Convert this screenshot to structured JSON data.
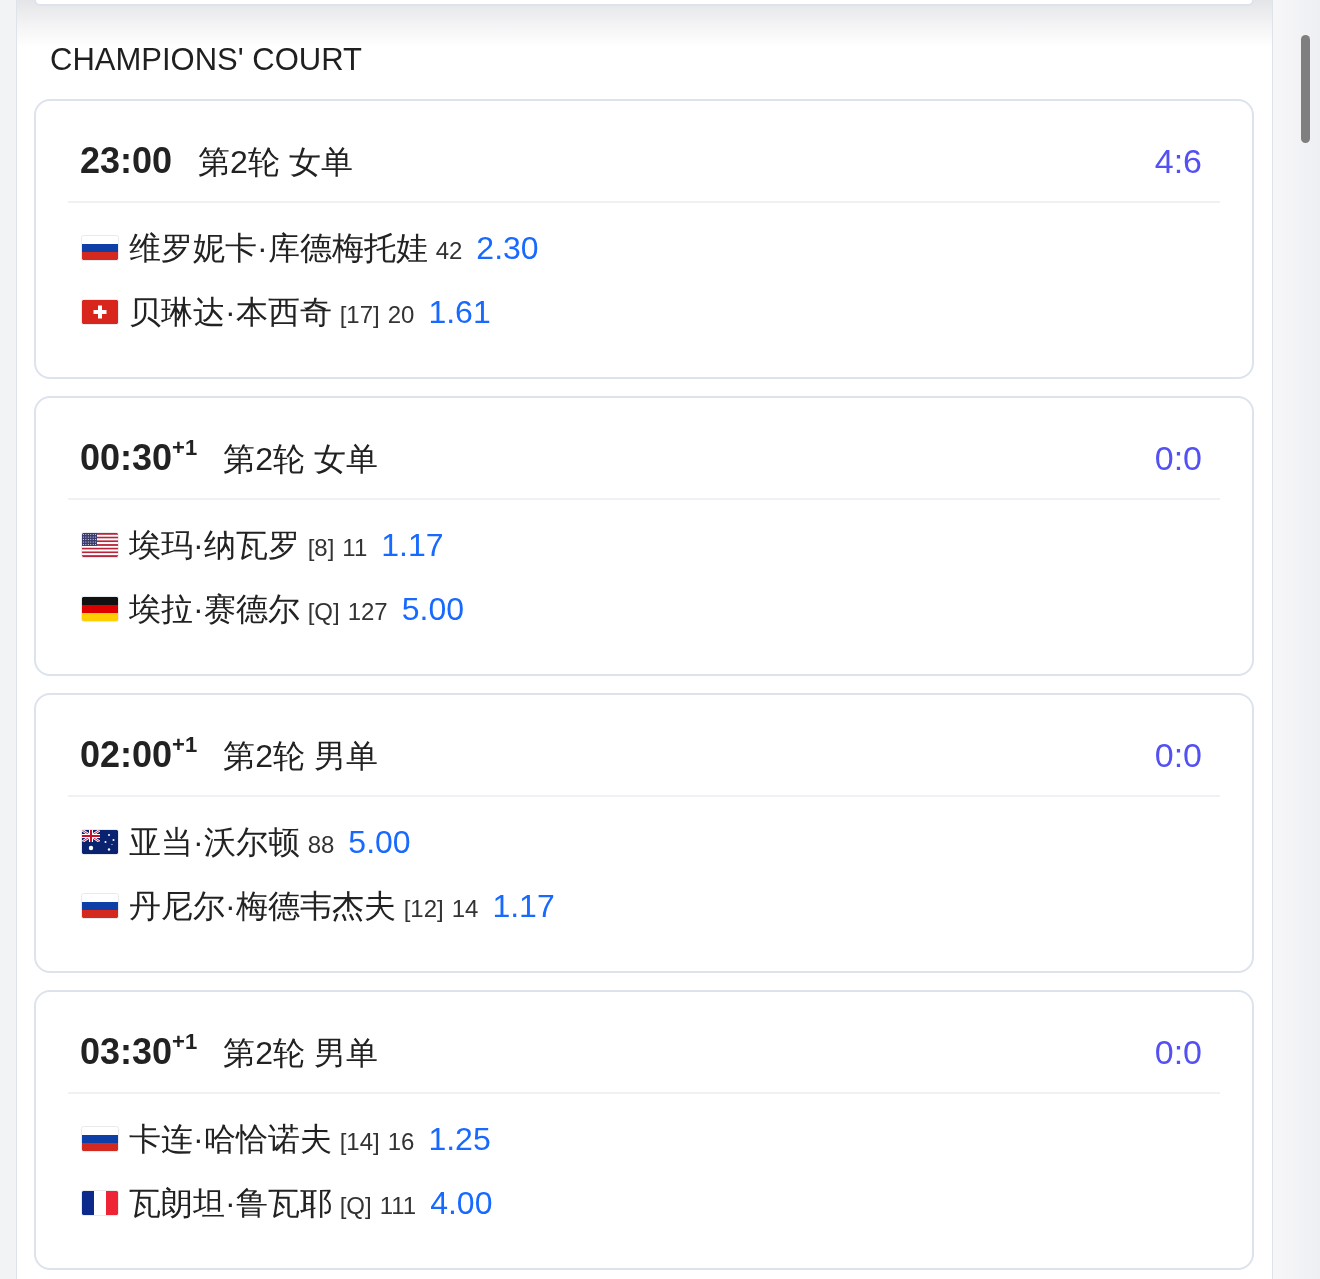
{
  "section": {
    "title": "CHAMPIONS' COURT"
  },
  "matches": [
    {
      "time": "23:00",
      "round": "第2轮 女单",
      "score": "4:6",
      "players": [
        {
          "kind": "russia",
          "name": "维罗妮卡·库德梅托娃",
          "rank": "42",
          "odds": "2.30"
        },
        {
          "kind": "switzerland",
          "name": "贝琳达·本西奇",
          "seed": "[17]",
          "rank": "20",
          "odds": "1.61"
        }
      ]
    },
    {
      "time": "00:30$^{+1}$",
      "round": "第2轮 女单",
      "score": "0:0",
      "players": [
        {
          "kind": "usa",
          "name": "埃玛·纳瓦罗",
          "seed": "[8]",
          "rank": "11",
          "odds": "1.17"
        },
        {
          "kind": "germany",
          "name": "埃拉·赛德尔",
          "seed": "[Q]",
          "rank": "127",
          "odds": "5.00"
        }
      ]
    },
    {
      "time": "02:00$^{+1}$",
      "round": "第2轮 男单",
      "score": "0:0",
      "players": [
        {
          "kind": "australia",
          "name": "亚当·沃尔顿",
          "rank": "88",
          "odds": "5.00"
        },
        {
          "kind": "russia",
          "name": "丹尼尔·梅德韦杰夫",
          "seed": "[12]",
          "rank": "14",
          "odds": "1.17"
        }
      ]
    },
    {
      "time": "03:30$^{+1}$",
      "round": "第2轮 男单",
      "score": "0:0",
      "players": [
        {
          "kind": "russia",
          "name": "卡连·哈恰诺夫",
          "seed": "[14]",
          "rank": "16",
          "odds": "1.25"
        },
        {
          "kind": "france",
          "name": "瓦朗坦·鲁瓦耶",
          "seed": "[Q]",
          "rank": "111",
          "odds": "4.00"
        }
      ]
    }
  ]
}
